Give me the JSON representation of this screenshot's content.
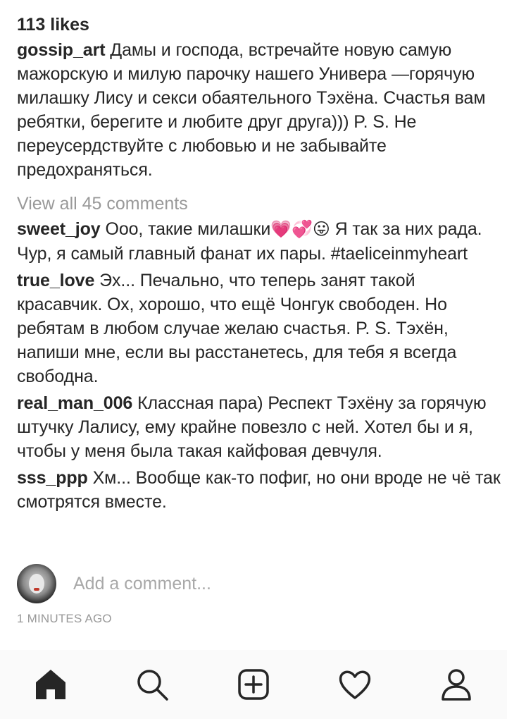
{
  "post": {
    "likes": "113 likes",
    "caption": {
      "user": "gossip_art",
      "text": "Дамы и господа, встречайте новую самую мажорскую и милую парочку нашего Универа —горячую милашку Лису и секси обаятельного Тэхёна. Счастья вам ребятки, берегите и любите друг друга))) P. S. Не переусердствуйте с любовью и не забывайте предохраняться."
    },
    "view_all": "View all 45 comments",
    "comments": [
      {
        "user": "sweet_joy",
        "text_before": "Ооо, такие милашки",
        "emojis": "💗💞😛",
        "text_after": " Я так за них рада. Чур, я самый главный фанат их пары. #taeliceinmyheart"
      },
      {
        "user": "true_love",
        "text": "Эх... Печально, что теперь занят такой красавчик. Ох, хорошо, что ещё Чонгук свободен. Но ребятам в любом случае желаю счастья. P. S. Тэхён, напиши мне, если вы расстанетесь, для тебя я всегда свободна."
      },
      {
        "user": "real_man_006",
        "text": "Классная пара) Респект Тэхёну за горячую штучку Лалису, ему крайне повезло с ней. Хотел бы и я, чтобы у меня была такая кайфовая девчуля."
      },
      {
        "user": "sss_ppp",
        "text": "Хм... Вообще как-то пофиг, но они вроде не чё так смотрятся вместе."
      }
    ],
    "add_comment_placeholder": "Add a comment...",
    "timestamp": "1 MINUTES AGO"
  },
  "nav": {
    "items": [
      "home-icon",
      "search-icon",
      "add-post-icon",
      "heart-icon",
      "profile-icon"
    ]
  },
  "colors": {
    "text": "#262626",
    "muted": "#999999",
    "nav_bg": "#fafafa"
  }
}
